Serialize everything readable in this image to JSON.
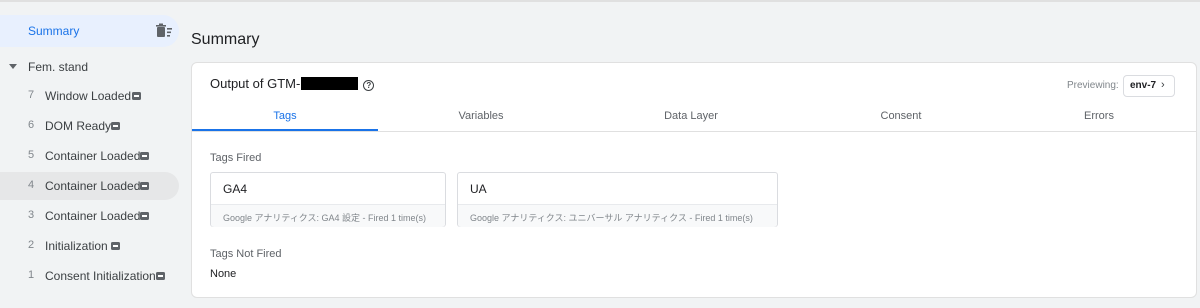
{
  "sidebar": {
    "summary_label": "Summary",
    "container_label": "Fem. stand",
    "events": [
      {
        "num": "7",
        "label": "Window Loaded"
      },
      {
        "num": "6",
        "label": "DOM Ready"
      },
      {
        "num": "5",
        "label": "Container Loaded"
      },
      {
        "num": "4",
        "label": "Container Loaded"
      },
      {
        "num": "3",
        "label": "Container Loaded"
      },
      {
        "num": "2",
        "label": "Initialization"
      },
      {
        "num": "1",
        "label": "Consent Initialization"
      }
    ]
  },
  "main": {
    "page_title": "Summary",
    "output_title": "Output of GTM-",
    "previewing_label": "Previewing:",
    "env_label": "env-7",
    "tabs": [
      "Tags",
      "Variables",
      "Data Layer",
      "Consent",
      "Errors"
    ],
    "tags_fired_label": "Tags Fired",
    "tags": [
      {
        "name": "GA4",
        "desc": "Google アナリティクス: GA4 設定 - Fired 1 time(s)"
      },
      {
        "name": "UA",
        "desc": "Google アナリティクス: ユニバーサル アナリティクス - Fired 1 time(s)"
      }
    ],
    "tags_not_fired_label": "Tags Not Fired",
    "none_text": "None"
  },
  "colors": {
    "accent": "#1a73e8",
    "highlight": "#e8f0fe",
    "background": "#f1f3f4"
  }
}
